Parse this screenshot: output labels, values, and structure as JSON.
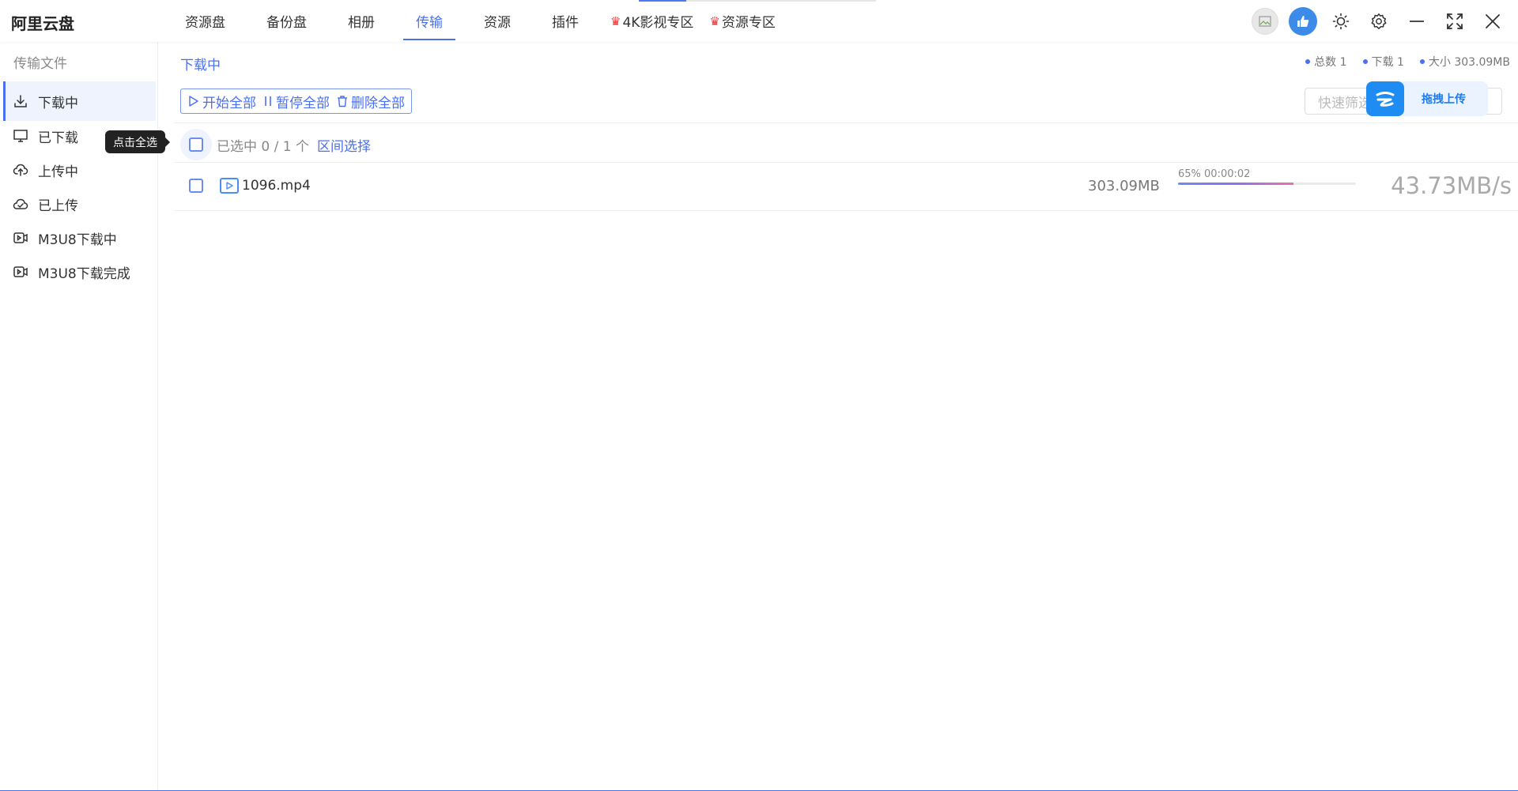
{
  "app": {
    "title": "阿里云盘"
  },
  "nav": {
    "tabs": [
      {
        "label": "资源盘"
      },
      {
        "label": "备份盘"
      },
      {
        "label": "相册"
      },
      {
        "label": "传输"
      },
      {
        "label": "资源"
      },
      {
        "label": "插件"
      }
    ],
    "promo": [
      {
        "label": "4K影视专区"
      },
      {
        "label": "资源专区"
      }
    ],
    "accent_color": "#4a6ff0"
  },
  "sidebar": {
    "heading": "传输文件",
    "items": [
      {
        "label": "下载中",
        "icon": "download-icon"
      },
      {
        "label": "已下载",
        "icon": "monitor-icon"
      },
      {
        "label": "上传中",
        "icon": "cloud-upload-icon"
      },
      {
        "label": "已上传",
        "icon": "cloud-check-icon"
      },
      {
        "label": "M3U8下载中",
        "icon": "video-icon"
      },
      {
        "label": "M3U8下载完成",
        "icon": "video-icon"
      }
    ]
  },
  "tooltip": {
    "text": "点击全选"
  },
  "main": {
    "breadcrumb": "下载中",
    "stats": {
      "total": "总数 1",
      "downloading": "下载 1",
      "size": "大小 303.09MB"
    },
    "toolbar": {
      "start_all": "开始全部",
      "pause_all": "暂停全部",
      "delete_all": "删除全部"
    },
    "search": {
      "placeholder": "快速筛选"
    },
    "upload": {
      "label": "拖拽上传"
    },
    "selection": {
      "text": "已选中 0 / 1 个",
      "range_select": "区间选择"
    },
    "files": [
      {
        "name": "1096.mp4",
        "size": "303.09MB",
        "progress_text": "65% 00:00:02",
        "progress_percent": 65,
        "speed": "43.73MB/s"
      }
    ]
  }
}
